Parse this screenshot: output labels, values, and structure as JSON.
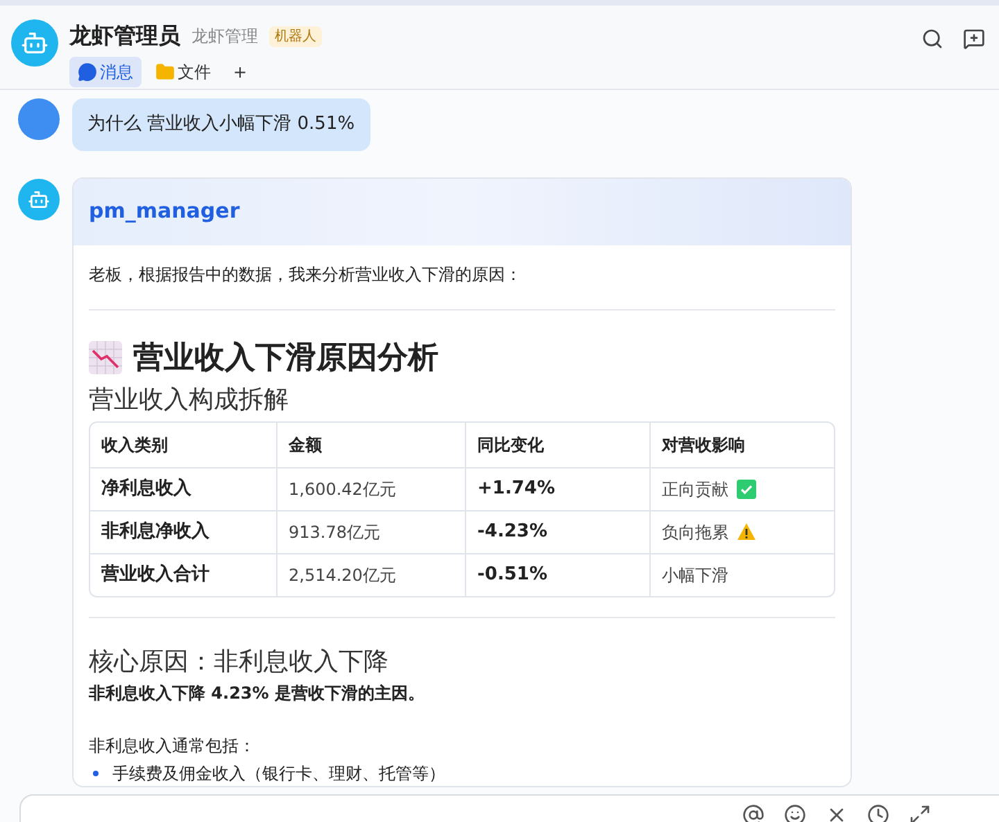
{
  "header": {
    "title": "龙虾管理员",
    "subtitle": "龙虾管理",
    "badge": "机器人"
  },
  "tabs": [
    {
      "label": "消息",
      "selected": true,
      "kind": "chat"
    },
    {
      "label": "文件",
      "selected": false,
      "kind": "folder"
    },
    {
      "label": "+",
      "selected": false,
      "kind": "add"
    }
  ],
  "user_message": {
    "text": "为什么 营业收入小幅下滑 0.51%"
  },
  "bot_message": {
    "sender": "pm_manager",
    "intro": "老板，根据报告中的数据，我来分析营业收入下滑的原因：",
    "heading": "营业收入下滑原因分析",
    "subheading": "营业收入构成拆解",
    "table": {
      "columns": [
        "收入类别",
        "金额",
        "同比变化",
        "对营收影响"
      ],
      "rows": [
        {
          "cells": [
            "净利息收入",
            "1,600.42亿元",
            "+1.74%",
            "正向贡献"
          ],
          "kind": "positive"
        },
        {
          "cells": [
            "非利息净收入",
            "913.78亿元",
            "-4.23%",
            "负向拖累"
          ],
          "kind": "warning"
        },
        {
          "cells": [
            "营业收入合计",
            "2,514.20亿元",
            "-0.51%",
            "小幅下滑"
          ],
          "kind": "plain"
        }
      ]
    },
    "section_title": "核心原因：非利息收入下降",
    "section_lead": "非利息收入下降 4.23% 是营收下滑的主因。",
    "list_intro": "非利息收入通常包括：",
    "bullets": [
      "手续费及佣金收入（银行卡、理财、托管等）"
    ]
  }
}
